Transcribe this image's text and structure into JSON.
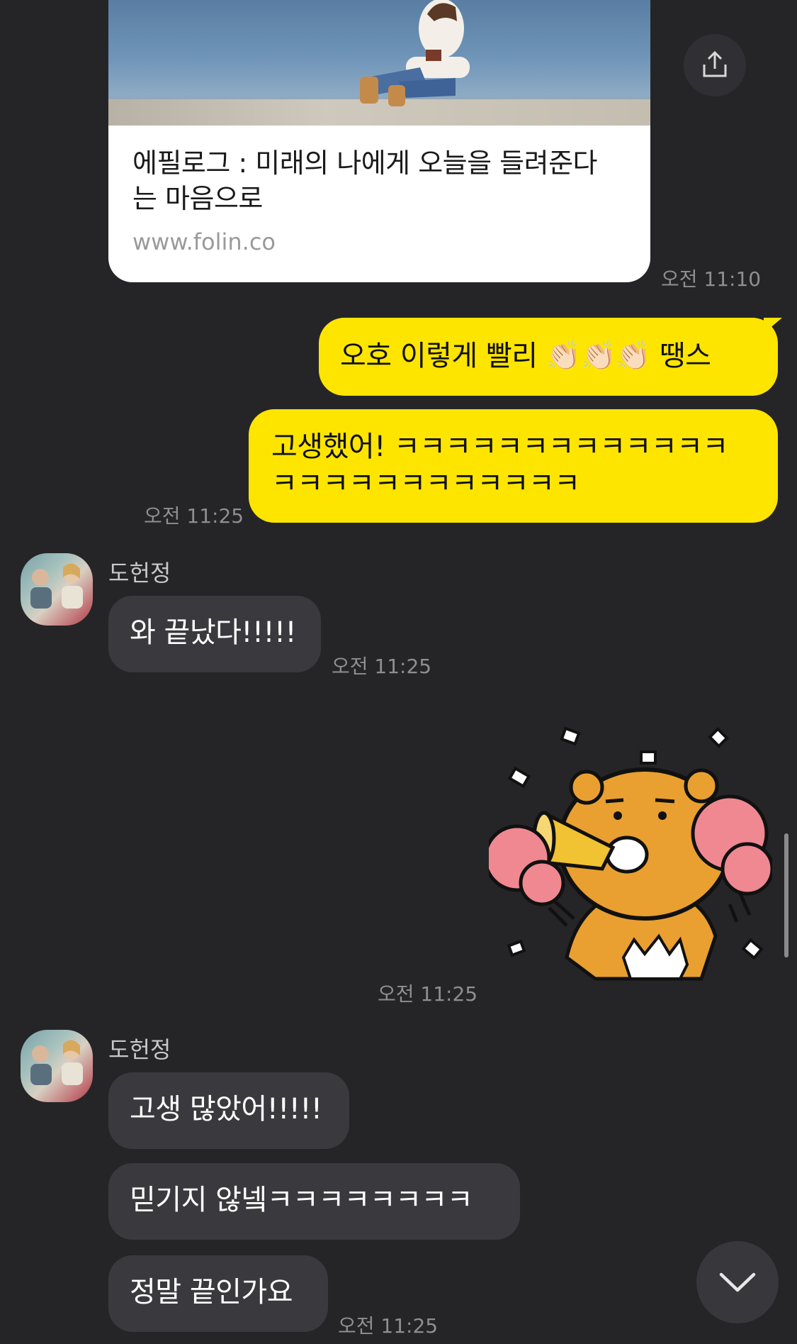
{
  "link_card": {
    "title_line1": "에필로그 : 미래의 나에게 오늘을 들려준다",
    "title_line2": "는 마음으로",
    "url": "www.folin.co",
    "time": "오전 11:10"
  },
  "messages_mine": {
    "msg1": "오호 이렇게 빨리 👏🏻👏🏻👏🏻 땡스",
    "msg2_line1": "고생했어! ㅋㅋㅋㅋㅋㅋㅋㅋㅋㅋㅋㅋㅋ",
    "msg2_line2": "ㅋㅋㅋㅋㅋㅋㅋㅋㅋㅋㅋㅋ",
    "time": "오전 11:25"
  },
  "group1": {
    "sender": "도헌정",
    "msg": "와 끝났다!!!!!",
    "time": "오전 11:25"
  },
  "sticker": {
    "name": "ryan-cheering-sticker",
    "time": "오전 11:25"
  },
  "group2": {
    "sender": "도헌정",
    "msg1": "고생 많았어!!!!!",
    "msg2": "믿기지 않넼ㅋㅋㅋㅋㅋㅋㅋㅋ",
    "msg3": "정말 끝인가요",
    "time": "오전 11:25"
  },
  "colors": {
    "background": "#252528",
    "my_bubble": "#fee500",
    "their_bubble": "#3a3a3e"
  }
}
